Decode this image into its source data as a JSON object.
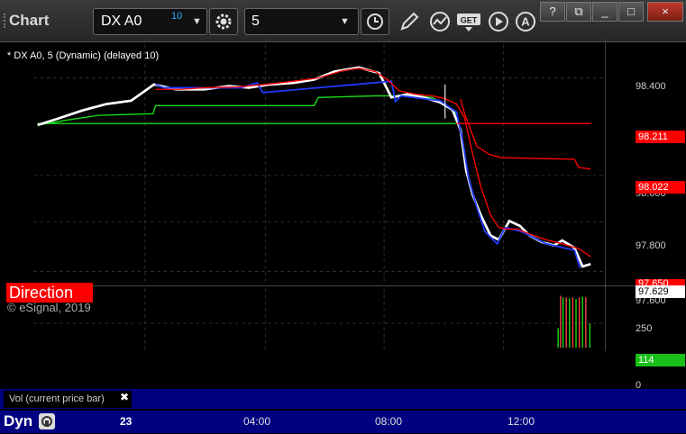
{
  "toolbar": {
    "title": "Chart",
    "symbol": "DX A0",
    "symbol_delay": "10",
    "interval": "5"
  },
  "window_buttons": [
    "?",
    "⧉",
    "_",
    "□",
    "×"
  ],
  "chart": {
    "header": "* DX A0, 5 (Dynamic) (delayed 10)",
    "price_ticks": [
      "98.400",
      "98.000",
      "97.800",
      "97.600"
    ],
    "tags": {
      "upper": "98.211",
      "mid": "98.022",
      "mid_dim": "97.650",
      "last": "97.629"
    },
    "direction_label": "Direction",
    "copyright": "© eSignal, 2019",
    "volume_ticks": [
      "250",
      "114",
      "0"
    ],
    "volume_label": "Vol (current price bar)",
    "x_ticks": [
      "23",
      "04:00",
      "08:00",
      "12:00"
    ],
    "mode": "Dyn",
    "colors": {
      "up": "#ffffff",
      "down": "#1f3bff",
      "fast_ma": "#ff0000",
      "slow_ma": "#18e018",
      "axis_bg": "#000080"
    }
  }
}
